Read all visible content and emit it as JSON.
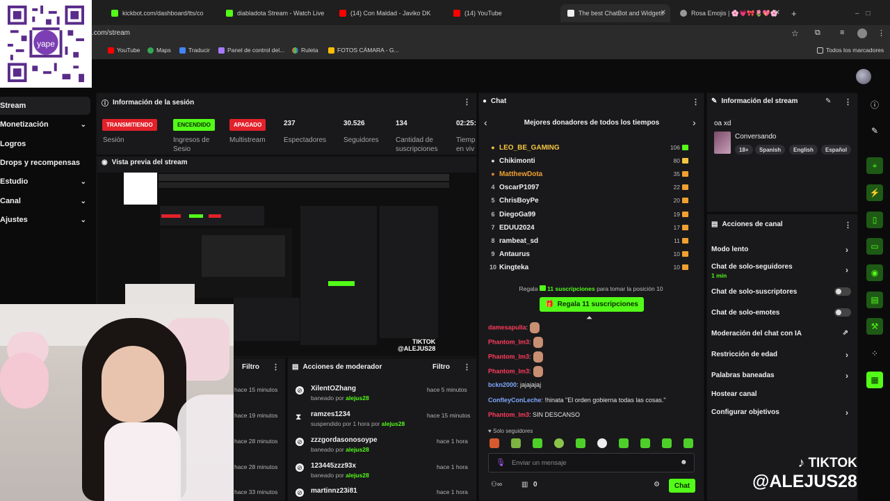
{
  "browser": {
    "tabs": [
      {
        "label": "kickbot.com/dashboard/tts/co"
      },
      {
        "label": "diabladota Stream - Watch Live"
      },
      {
        "label": "(14) Con Maldad - Javiko DK"
      },
      {
        "label": "(14) YouTube"
      },
      {
        "label": "The best ChatBot and Widgets"
      },
      {
        "label": "Rosa Emojis | 🌸💗🎀🌷💖🌸"
      }
    ],
    "new_tab": "+",
    "url": ".com/stream",
    "bookmarks": [
      {
        "label": "YouTube"
      },
      {
        "label": "Maps"
      },
      {
        "label": "Traducir"
      },
      {
        "label": "Panel de control del..."
      },
      {
        "label": "Ruleta"
      },
      {
        "label": "FOTOS CÁMARA - G..."
      }
    ],
    "all_bookmarks": "Todos los marcadores"
  },
  "qr": {
    "brand": "yape"
  },
  "nav": {
    "items": [
      {
        "label": "Stream",
        "chevron": ""
      },
      {
        "label": "Monetización",
        "chevron": "⌄"
      },
      {
        "label": "Logros",
        "chevron": ""
      },
      {
        "label": "Drops y recompensas",
        "chevron": ""
      },
      {
        "label": "Estudio",
        "chevron": "⌄"
      },
      {
        "label": "Canal",
        "chevron": "⌄"
      },
      {
        "label": "Ajustes",
        "chevron": "⌄"
      }
    ]
  },
  "session": {
    "title": "Información de la sesión",
    "badges": [
      {
        "label": "TRANSMITIENDO",
        "caption": "Sesión"
      },
      {
        "label": "ENCENDIDO",
        "caption": "Ingresos de Sesio"
      },
      {
        "label": "APAGADO",
        "caption": "Multistream"
      }
    ],
    "stats": [
      {
        "value": "237",
        "label": "Espectadores"
      },
      {
        "value": "30.526",
        "label": "Seguidores"
      },
      {
        "value": "134",
        "label": "Cantidad de suscripciones"
      },
      {
        "value": "02:25:",
        "label": "Tiemp en viv"
      }
    ]
  },
  "preview": {
    "title": "Vista previa del stream"
  },
  "moderator": {
    "title": "Acciones de moderador",
    "filter": "Filtro",
    "left_filter": "Filtro",
    "left_times": [
      "hace 15 minutos",
      "hace 19 minutos",
      "hace 28 minutos",
      "hace 28 minutos",
      "hace 33 minutos"
    ],
    "items": [
      {
        "name": "XilentOZhang",
        "action": "baneado por",
        "by": "alejus28",
        "time": "hace 5 minutos"
      },
      {
        "name": "ramzes1234",
        "action": "suspendido por 1 hora por",
        "by": "alejus28",
        "time": "hace 15 minutos"
      },
      {
        "name": "zzzgordasonosoype",
        "action": "baneado por",
        "by": "alejus28",
        "time": "hace 1 hora"
      },
      {
        "name": "123445zzz93x",
        "action": "baneado por",
        "by": "alejus28",
        "time": "hace 1 hora"
      },
      {
        "name": "martinnz23i81",
        "action": "",
        "by": "",
        "time": "hace 1 hora"
      }
    ]
  },
  "chat": {
    "title": "Chat",
    "leaderboard_title": "Mejores donadores de todos los tiempos",
    "donors": [
      {
        "rank": "",
        "name": "LEO_BE_GAMING",
        "amount": "106"
      },
      {
        "rank": "",
        "name": "Chikimonti",
        "amount": "80"
      },
      {
        "rank": "",
        "name": "MatthewDota",
        "amount": "35"
      },
      {
        "rank": "4",
        "name": "OscarP1097",
        "amount": "22"
      },
      {
        "rank": "5",
        "name": "ChrisBoyPe",
        "amount": "20"
      },
      {
        "rank": "6",
        "name": "DiegoGa99",
        "amount": "19"
      },
      {
        "rank": "7",
        "name": "EDUU2024",
        "amount": "17"
      },
      {
        "rank": "8",
        "name": "rambeat_sd",
        "amount": "11"
      },
      {
        "rank": "9",
        "name": "Antaurus",
        "amount": "10"
      },
      {
        "rank": "10",
        "name": "Kingteka",
        "amount": "10"
      }
    ],
    "gift_prompt_pre": "Regala",
    "gift_prompt_count": "11 suscripciones",
    "gift_prompt_post": "para tomar la posición 10",
    "gift_button": "Regala 11 suscripciones",
    "messages": [
      {
        "user": "damesapulla",
        "text": "",
        "sticker": true,
        "color": "#ff3b5c"
      },
      {
        "user": "Phantom_lm3",
        "text": "",
        "sticker": true,
        "color": "#ff3b5c"
      },
      {
        "user": "Phantom_lm3",
        "text": "",
        "sticker": true,
        "color": "#ff3b5c"
      },
      {
        "user": "Phantom_lm3",
        "text": "",
        "sticker": true,
        "color": "#ff3b5c"
      },
      {
        "user": "bckn2000",
        "text": "jajajajaj",
        "sticker": false,
        "color": "#7fa8ff"
      },
      {
        "user": "ConfleyConLeche",
        "text": "!hinata \"El orden gobierna todas las cosas.\"",
        "sticker": false,
        "color": "#7fa8ff"
      },
      {
        "user": "Phantom_lm3",
        "text": "SIN DESCANSO",
        "sticker": false,
        "color": "#ff3b5c"
      }
    ],
    "followers_only": "Solo seguidores",
    "input_placeholder": "Enviar un mensaje",
    "viewer_count": "0",
    "send_button": "Chat"
  },
  "stream_info": {
    "title": "Información del stream",
    "stream_title": "oa xd",
    "category": "Conversando",
    "tags": [
      "18+",
      "Spanish",
      "English",
      "Español"
    ]
  },
  "channel_actions": {
    "title": "Acciones de canal",
    "items": [
      {
        "label": "Modo lento",
        "sub": "",
        "control": "chevron"
      },
      {
        "label": "Chat de solo-seguidores",
        "sub": "1 min",
        "control": "chevron"
      },
      {
        "label": "Chat de solo-suscriptores",
        "sub": "",
        "control": "toggle"
      },
      {
        "label": "Chat de solo-emotes",
        "sub": "",
        "control": "toggle"
      },
      {
        "label": "Moderación del chat con IA",
        "sub": "",
        "control": "external"
      },
      {
        "label": "Restricción de edad",
        "sub": "",
        "control": "chevron"
      },
      {
        "label": "Palabras baneadas",
        "sub": "",
        "control": "chevron"
      },
      {
        "label": "Hostear canal",
        "sub": "",
        "control": "none"
      },
      {
        "label": "Configurar objetivos",
        "sub": "",
        "control": "chevron"
      }
    ]
  },
  "watermark": {
    "line1": "TIKTOK",
    "line2": "@ALEJUS28"
  },
  "preview_watermark": {
    "line1": "TIKTOK",
    "line2": "@ALEJUS28"
  },
  "colors": {
    "accent": "#53fc18",
    "live": "#e3212b",
    "panel": "#19191b",
    "background": "#0b0b0c"
  }
}
